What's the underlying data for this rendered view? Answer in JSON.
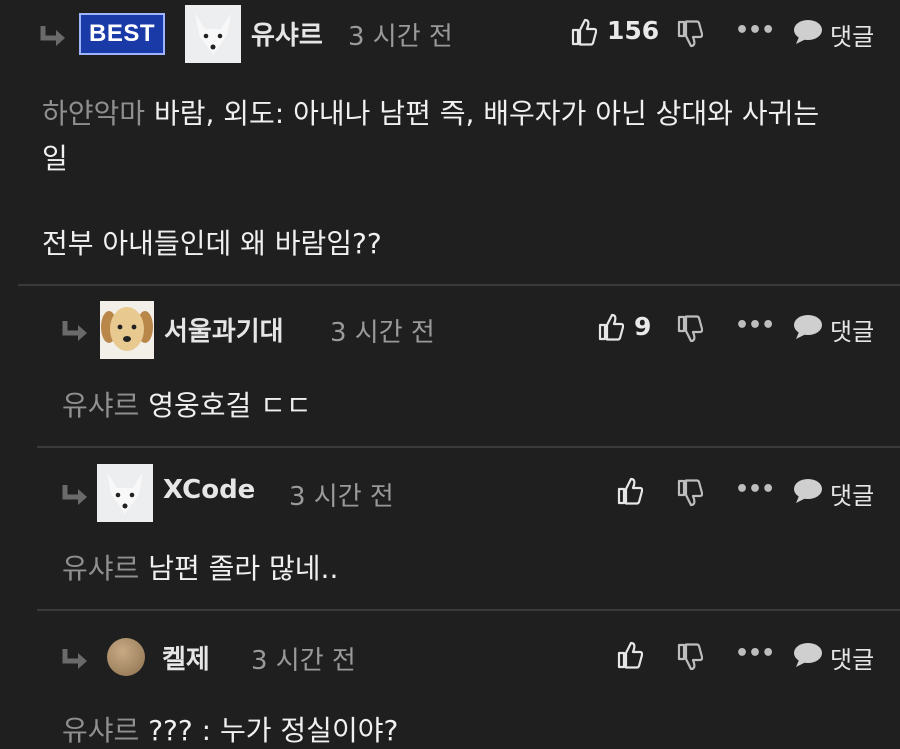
{
  "actions": {
    "reply_label": "댓글",
    "more": "•••"
  },
  "comments": [
    {
      "badge": "BEST",
      "author": "유샤르",
      "time": "3 시간 전",
      "likes": "156",
      "mention": "하얀악마",
      "body_line1": "바람, 외도: 아내나 남편 즉, 배우자가 아닌 상대와 사귀는",
      "body_line2": "일",
      "body_line3": "전부 아내들인데 왜 바람임??"
    },
    {
      "author": "서울과기대",
      "time": "3 시간 전",
      "likes": "9",
      "mention": "유샤르",
      "body": "영웅호걸 ㄷㄷ"
    },
    {
      "author": "XCode",
      "time": "3 시간 전",
      "likes": "",
      "mention": "유샤르",
      "body": "남편 졸라 많네.."
    },
    {
      "author": "켈제",
      "time": "3 시간 전",
      "likes": "",
      "mention": "유샤르",
      "body": "??? : 누가 정실이야?"
    }
  ]
}
